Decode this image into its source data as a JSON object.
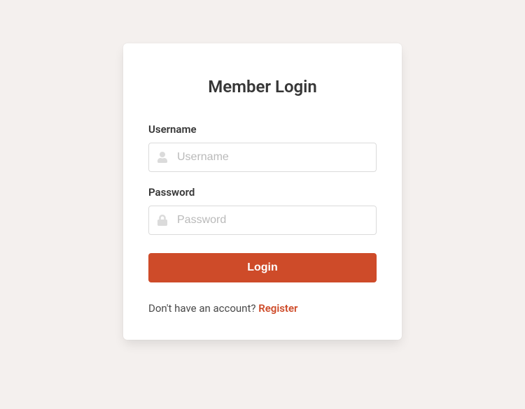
{
  "title": "Member Login",
  "username": {
    "label": "Username",
    "placeholder": "Username",
    "value": ""
  },
  "password": {
    "label": "Password",
    "placeholder": "Password",
    "value": ""
  },
  "login_button": "Login",
  "register_prompt": "Don't have an account? ",
  "register_link": "Register",
  "colors": {
    "primary": "#ce4b29",
    "background": "#f4f0ee"
  }
}
